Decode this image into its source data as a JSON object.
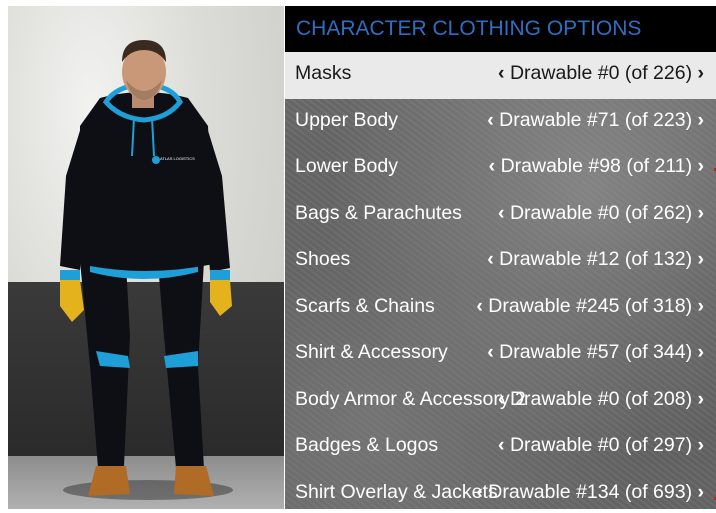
{
  "menu": {
    "title": "CHARACTER CLOTHING OPTIONS",
    "selected_index": 0,
    "items": [
      {
        "label": "Masks",
        "value": "Drawable #0 (of 226)"
      },
      {
        "label": "Upper Body",
        "value": "Drawable #71 (of 223)"
      },
      {
        "label": "Lower Body",
        "value": "Drawable #98 (of 211)"
      },
      {
        "label": "Bags & Parachutes",
        "value": "Drawable #0 (of 262)"
      },
      {
        "label": "Shoes",
        "value": "Drawable #12 (of 132)"
      },
      {
        "label": "Scarfs & Chains",
        "value": "Drawable #245 (of 318)"
      },
      {
        "label": "Shirt & Accessory",
        "value": "Drawable #57 (of 344)"
      },
      {
        "label": "Body Armor & Accessory 2",
        "value": "Drawable #0 (of 208)"
      },
      {
        "label": "Badges & Logos",
        "value": "Drawable #0 (of 297)"
      },
      {
        "label": "Shirt Overlay & Jackets",
        "value": "Drawable #134 (of 693)"
      }
    ],
    "arrow_left": "‹",
    "arrow_right": "›"
  },
  "preview": {
    "hoodie_logo_text": "ATLAS LOGISTICS"
  },
  "colors": {
    "header_bg": "#000000",
    "title_text": "#2e6fc4",
    "selected_row_bg": "#eaeaea",
    "selected_row_text": "#1a1a1a",
    "row_text": "#ffffff",
    "hoodie": "#0d0f14",
    "hoodie_accent": "#1e9fd8",
    "gloves": "#e4b21d",
    "boots": "#b06b26"
  }
}
